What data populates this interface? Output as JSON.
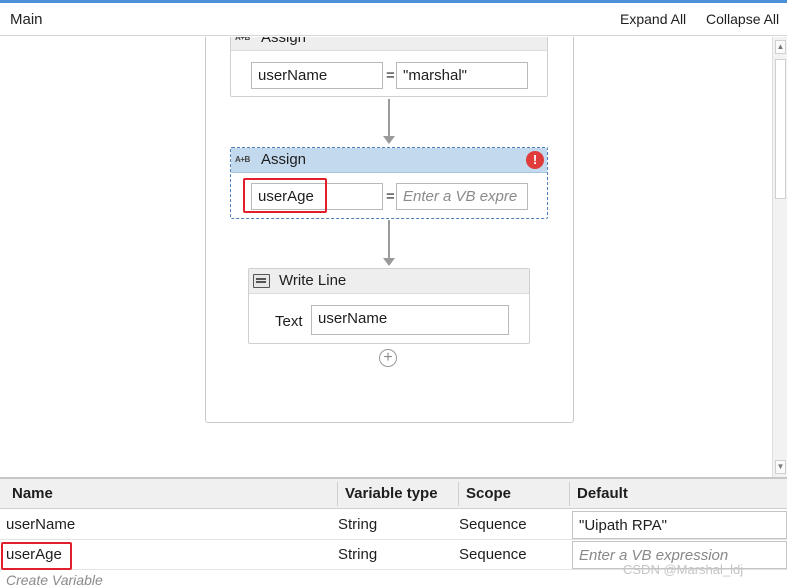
{
  "header": {
    "title": "Main",
    "expand_all": "Expand All",
    "collapse_all": "Collapse All"
  },
  "workflow": {
    "assign1": {
      "title": "Assign",
      "icon": "A+B",
      "to_value": "userName",
      "equals": "=",
      "value": "\"marshal\""
    },
    "assign2": {
      "title": "Assign",
      "icon": "A+B",
      "to_value": "userAge",
      "equals": "=",
      "value_placeholder": "Enter a VB expre",
      "error_icon": "!"
    },
    "write_line": {
      "title": "Write Line",
      "text_label": "Text",
      "text_value": "userName"
    },
    "add_icon": "+"
  },
  "variables": {
    "columns": [
      "Name",
      "Variable type",
      "Scope",
      "Default"
    ],
    "rows": [
      {
        "name": "userName",
        "type": "String",
        "scope": "Sequence",
        "default": "\"Uipath RPA\""
      },
      {
        "name": "userAge",
        "type": "String",
        "scope": "Sequence",
        "default": "Enter a VB expression"
      }
    ],
    "create_variable": "Create Variable"
  },
  "watermark": "CSDN @Marshal_ldj",
  "colors": {
    "accent_strip": "#4a8fd8",
    "selected_header": "#c3d9ee",
    "error": "#e03c3c",
    "highlight_box": "#e0212d"
  }
}
